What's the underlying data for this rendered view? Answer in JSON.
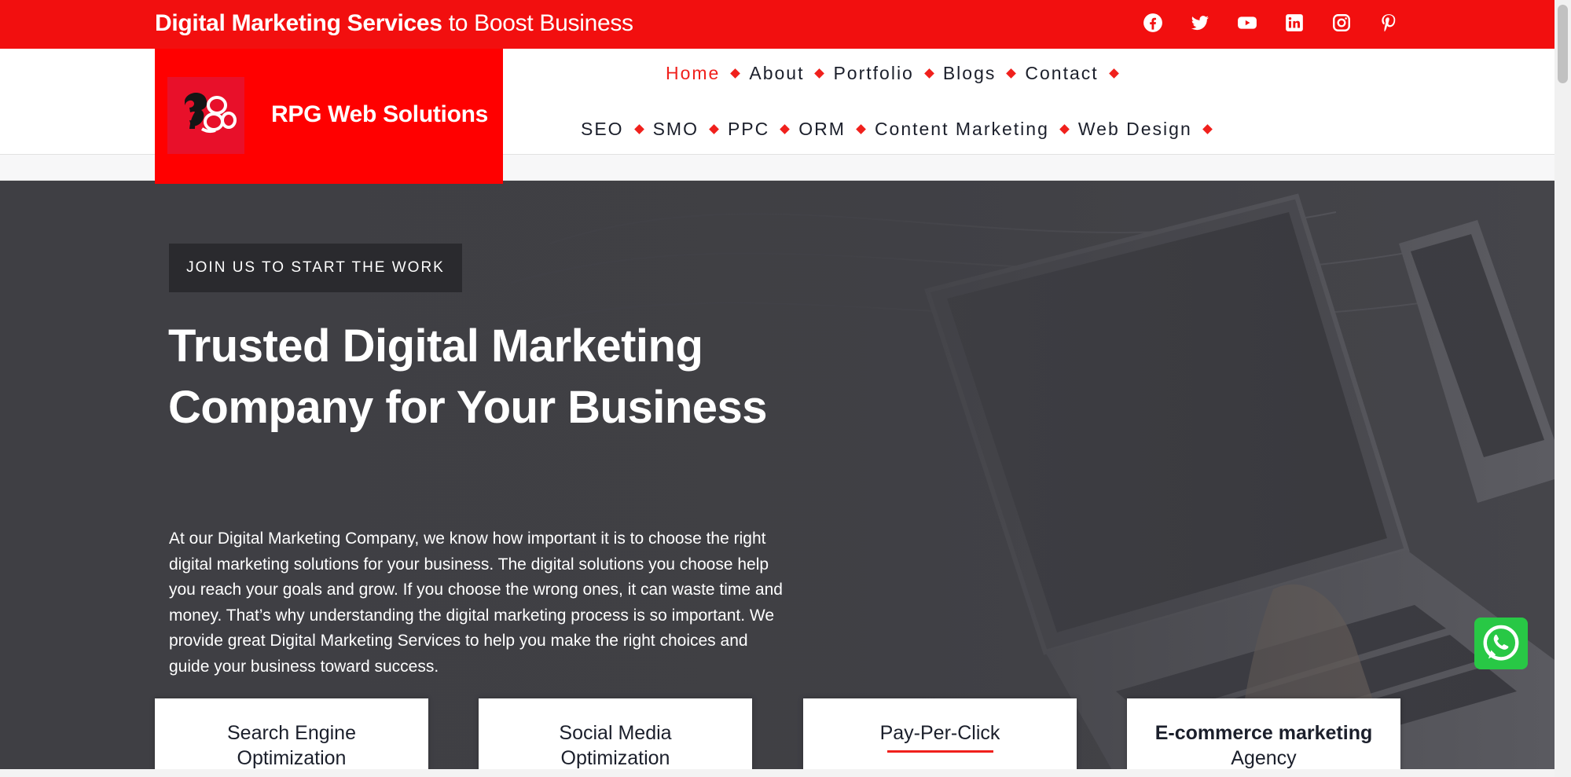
{
  "topbar": {
    "tagline_bold": "Digital Marketing Services",
    "tagline_rest": " to Boost Business",
    "background": "#f20f0f",
    "socials": [
      "facebook-icon",
      "twitter-icon",
      "youtube-icon",
      "linkedin-icon",
      "instagram-icon",
      "pinterest-icon"
    ]
  },
  "brand": {
    "name": "RPG Web Solutions",
    "background": "#ff0000"
  },
  "nav": {
    "primary": [
      {
        "label": "Home",
        "active": true
      },
      {
        "label": "About"
      },
      {
        "label": "Portfolio"
      },
      {
        "label": "Blogs"
      },
      {
        "label": "Contact"
      }
    ],
    "services": [
      {
        "label": "SEO"
      },
      {
        "label": "SMO"
      },
      {
        "label": "PPC"
      },
      {
        "label": "ORM"
      },
      {
        "label": "Content Marketing"
      },
      {
        "label": "Web Design"
      }
    ],
    "accent": "#f0201c"
  },
  "hero": {
    "badge": "JOIN US TO START THE WORK",
    "headline": "Trusted Digital Marketing Company for Your Business",
    "intro": "At our Digital Marketing Company, we know how important it is to choose the right digital marketing solutions for your business. The digital solutions you choose help you reach your goals and grow. If you choose the wrong ones, it can waste time and money. That’s why understanding the digital marketing process is so important. We provide great Digital Marketing Services to help you make the right choices and guide your business toward success."
  },
  "cards": [
    {
      "line1": "Search Engine",
      "line2": "Optimization"
    },
    {
      "line1": "Social Media",
      "line2": "Optimization"
    },
    {
      "line1": "Pay-Per-Click",
      "line2": ""
    },
    {
      "line1": "E-commerce marketing",
      "line2": "Agency"
    }
  ],
  "whatsapp": {
    "icon": "whatsapp-icon",
    "color": "#28c845"
  }
}
